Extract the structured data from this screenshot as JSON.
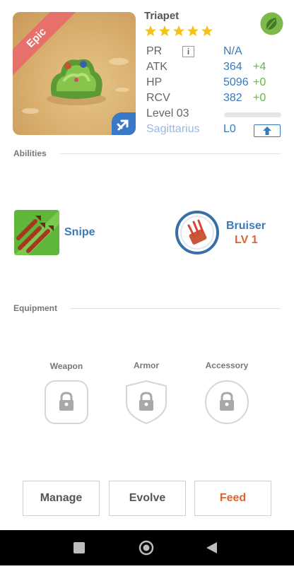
{
  "pet": {
    "name": "Triapet",
    "rarity": "Epic",
    "stars": 5,
    "element_icon": "leaf-icon",
    "type_icon": "airplane-icon"
  },
  "stats": {
    "pr": {
      "label": "PR",
      "value": "N/A"
    },
    "atk": {
      "label": "ATK",
      "value": "364",
      "bonus": "+4"
    },
    "hp": {
      "label": "HP",
      "value": "5096",
      "bonus": "+0"
    },
    "rcv": {
      "label": "RCV",
      "value": "382",
      "bonus": "+0"
    },
    "level": {
      "label": "Level 03",
      "progress": 0
    },
    "sign": {
      "label": "Sagittarius",
      "value": "L0"
    }
  },
  "abilities": {
    "title": "Abilities",
    "skill": {
      "name": "Snipe",
      "icon": "arrows-icon"
    },
    "passive": {
      "name": "Bruiser",
      "level": "LV 1",
      "icon": "claw-icon"
    }
  },
  "equipment": {
    "title": "Equipment",
    "slots": [
      {
        "label": "Weapon"
      },
      {
        "label": "Armor"
      },
      {
        "label": "Accessory"
      }
    ]
  },
  "actions": {
    "manage": "Manage",
    "evolve": "Evolve",
    "feed": "Feed"
  },
  "colors": {
    "accent_blue": "#3a7ab8",
    "bonus_green": "#69b64a",
    "feed_orange": "#e06430",
    "epic_ribbon": "#e8706a"
  }
}
